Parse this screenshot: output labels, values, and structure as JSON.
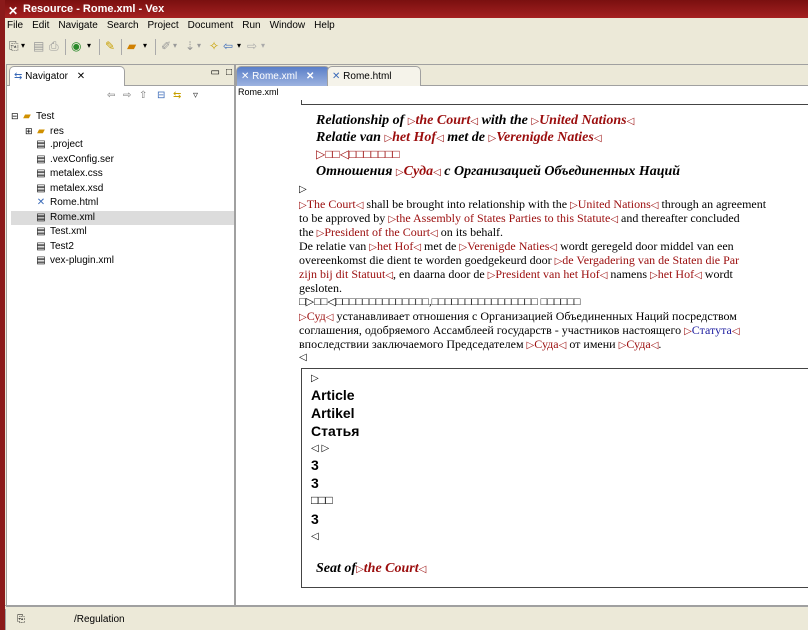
{
  "window": {
    "title": "Resource - Rome.xml - Vex"
  },
  "menu": [
    "File",
    "Edit",
    "Navigate",
    "Search",
    "Project",
    "Document",
    "Run",
    "Window",
    "Help"
  ],
  "navigator": {
    "tab_label": "Navigator",
    "tree": {
      "project": "Test",
      "items": [
        {
          "name": "res"
        },
        {
          "name": ".project"
        },
        {
          "name": ".vexConfig.ser"
        },
        {
          "name": "metalex.css"
        },
        {
          "name": "metalex.xsd"
        },
        {
          "name": "Rome.html"
        },
        {
          "name": "Rome.xml"
        },
        {
          "name": "Test.xml"
        },
        {
          "name": "Test2"
        },
        {
          "name": "vex-plugin.xml"
        }
      ]
    }
  },
  "editor": {
    "tabs": [
      {
        "label": "Rome.xml"
      },
      {
        "label": "Rome.html"
      }
    ],
    "breadcrumb": "Rome.xml",
    "content": {
      "h_en_a": "Relationship of ",
      "h_en_b": "the Court",
      "h_en_c": " with the ",
      "h_en_d": "United Nations",
      "h_nl_a": "Relatie van ",
      "h_nl_b": "het Hof",
      "h_nl_c": " met de ",
      "h_nl_d": "Verenigde Naties",
      "h_cjk": "▷□□◁□□□□□□□",
      "h_ru_a": "Отношения ",
      "h_ru_b": "Суда",
      "h_ru_c": " с Организацией Объединенных Наций",
      "p_en1_a": "The Court",
      "p_en1_b": " shall be brought into relationship with the ",
      "p_en1_c": "United Nations",
      "p_en1_d": " through an agreement",
      "p_en2_a": "to be approved by ",
      "p_en2_b": "the Assembly of States Parties to this Statute",
      "p_en2_c": " and thereafter concluded",
      "p_en3_a": "the ",
      "p_en3_b": "President of the Court",
      "p_en3_c": " on its behalf.",
      "p_nl1_a": "De relatie van ",
      "p_nl1_b": "het Hof",
      "p_nl1_c": " met de ",
      "p_nl1_d": "Verenigde Naties",
      "p_nl1_e": " wordt geregeld door middel van een",
      "p_nl2_a": "overeenkomst die dient te worden goedgekeurd door ",
      "p_nl2_b": "de Vergadering van de Staten die Par",
      "p_nl3_a": "zijn bij dit Statuut",
      "p_nl3_b": ", en daarna door de ",
      "p_nl3_c": "President van het Hof",
      "p_nl3_d": " namens ",
      "p_nl3_e": "het Hof",
      "p_nl3_f": " wordt",
      "p_nl4": "gesloten.",
      "p_cjk": "□▷□□◁□□□□□□□□□□□□□□,□□□□□□□□□□□□□□□□ □□□□□□",
      "p_ru1_a": "Суд",
      "p_ru1_b": " устанавливает отношения с Организацией Объединенных Наций посредством",
      "p_ru2_a": "соглашения, одобряемого Ассамблеей государств - участников настоящего ",
      "p_ru2_b": "Статута",
      "p_ru3_a": "впоследствии заключаемого Председателем ",
      "p_ru3_b": "Суда",
      "p_ru3_c": " от имени ",
      "p_ru3_d": "Суда",
      "art_en": "Article",
      "art_nl": "Artikel",
      "art_ru": "Статья",
      "num1": "3",
      "num2": "3",
      "num_cjk": "□□□",
      "num3": "3",
      "seat_a": "Seat of",
      "seat_b": "the Court"
    }
  },
  "status": {
    "path": "/Regulation"
  }
}
